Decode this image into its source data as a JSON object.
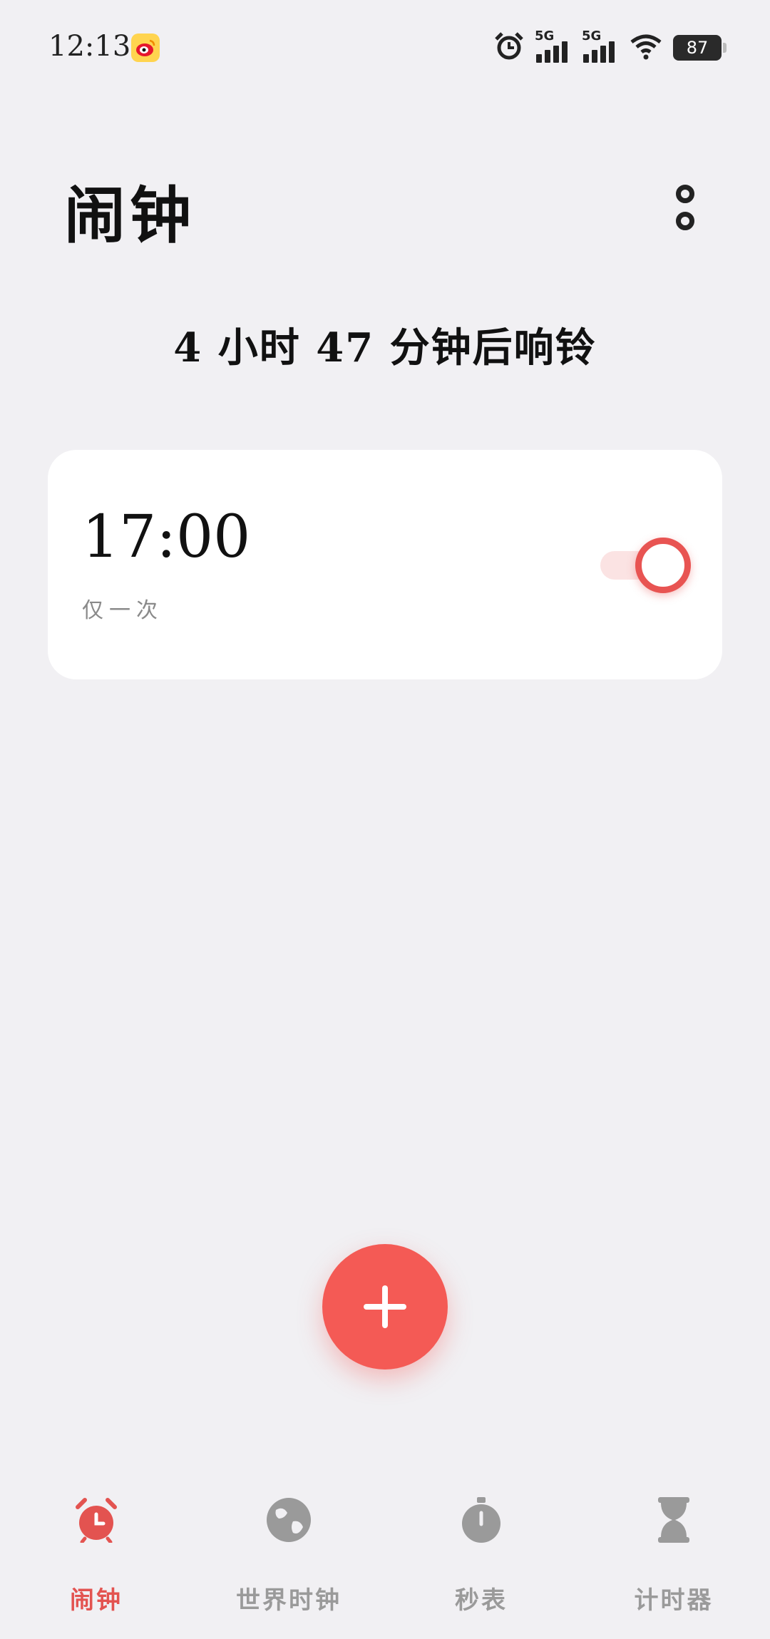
{
  "status_bar": {
    "time": "12:13",
    "notification_app_icon": "weibo-icon",
    "alarm_icon": "alarm-clock-icon",
    "signal_1_label": "5G",
    "signal_2_label": "5G",
    "wifi_icon": "wifi-icon",
    "battery_level": "87"
  },
  "header": {
    "title": "闹钟",
    "more_icon": "more-options-icon"
  },
  "countdown_text": "4 小时 47 分钟后响铃",
  "alarms": [
    {
      "time": "17:00",
      "repeat": "仅一次",
      "enabled": true
    }
  ],
  "fab": {
    "icon": "plus-icon"
  },
  "bottom_nav": {
    "items": [
      {
        "label": "闹钟",
        "icon": "alarm-clock-icon",
        "active": true
      },
      {
        "label": "世界时钟",
        "icon": "globe-icon",
        "active": false
      },
      {
        "label": "秒表",
        "icon": "stopwatch-icon",
        "active": false
      },
      {
        "label": "计时器",
        "icon": "hourglass-icon",
        "active": false
      }
    ]
  },
  "colors": {
    "accent": "#e35350",
    "fab": "#f45a55",
    "background": "#f1f0f3",
    "card": "#ffffff",
    "inactive": "#9a9a9a"
  }
}
